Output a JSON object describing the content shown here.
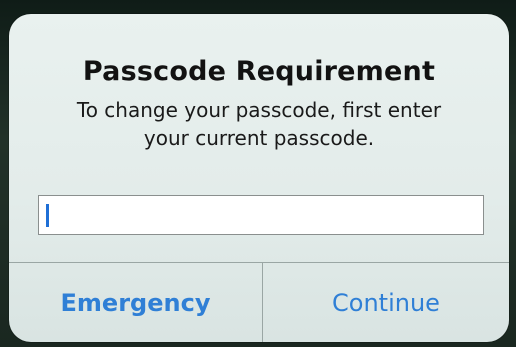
{
  "alert": {
    "title": "Passcode Requirement",
    "message_line1": "To change your passcode, first enter",
    "message_line2": "your current passcode.",
    "passcode_value": "",
    "buttons": {
      "emergency": "Emergency",
      "continue": "Continue"
    }
  },
  "colors": {
    "accent": "#2f7fd6",
    "caret": "#1f6fd6"
  }
}
